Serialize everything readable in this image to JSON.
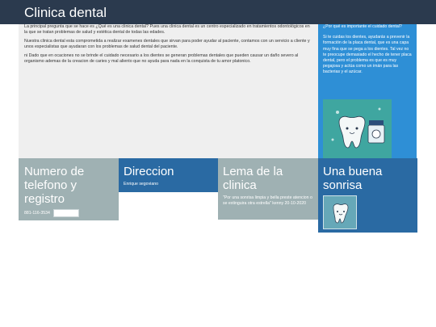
{
  "header": {
    "title": "Clinica dental"
  },
  "intro": {
    "paragraphs": [
      "La principal pregunta que se hace es ¿Qué es una clinica dental? Pues una clinica dental es un centro especializado en tratamientos odontológicos en la que se tratan problemas de salud y estética dental de todas las edades.",
      "Nuestra clinica dental esta comprometida a realizar examenes dentales que sirvan para poder ayudar al paciente, contamos con un servicio a cliente y unos especialistas que ayudaran con los problemas de salud dental del paciente.",
      "ni Dado que en ocaciones no se brinde el cuidado necesario a los dientes se generan problemas dentales que pueden causar un daño severo al organismo ademas de la creacion de caries y mal aliento que no ayuda para nada en la conquista de tu amor platonico."
    ]
  },
  "sidebar": {
    "question": "¿Por qué es importante el cuidado dental?",
    "answer": "Si te cuidas los dientes, ayudarás a prevenir la formación de la placa dental, que es una capa muy fina que se pega a los dientes. Tal vez no te preocupe demasiado el hecho de tener placa dental, pero el problema es que es muy pegajosa y actúa como un imán para las bacterias y el azúcar."
  },
  "cards": {
    "phone": {
      "title": "Numero de telefono y registro",
      "number": "881-116-3534",
      "register_label": "Registrarse"
    },
    "address": {
      "title": "Direccion",
      "text": "Enrique segoviano"
    },
    "motto": {
      "title": "Lema de la clinica",
      "quote": "\"Por una sonrisa limpia y bella preste atencion o se extinguira otra estrella\" kenny 20-10-2020"
    },
    "smile": {
      "title": "Una buena sonrisa"
    }
  },
  "colors": {
    "header": "#2b3a4e",
    "sidebar": "#2e8fd6",
    "card_gray": "#9fb1b3",
    "card_blue": "#2a6aa3"
  }
}
